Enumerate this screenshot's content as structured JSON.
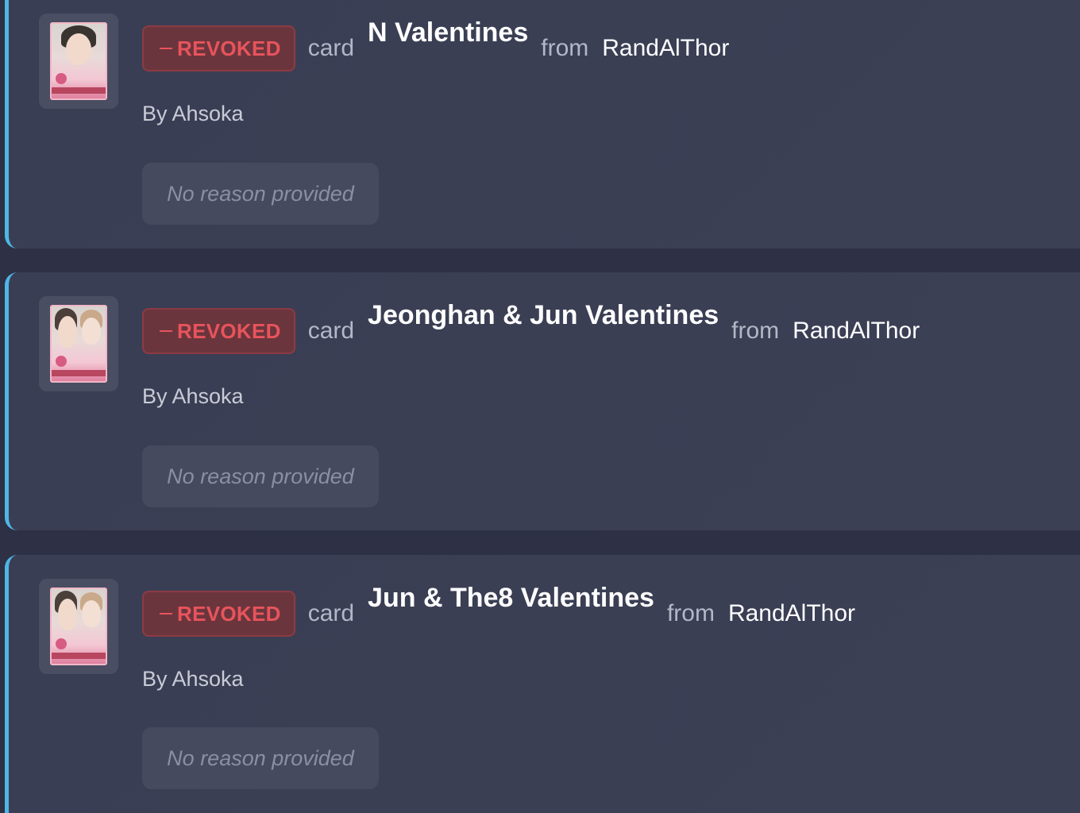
{
  "colors": {
    "accent_border": "#4fb6e8",
    "revoked_text": "#e8545c",
    "revoked_bg": "#6b353d",
    "card_bg": "#3a3e54",
    "page_bg": "#2e3145"
  },
  "entries": [
    {
      "status": "REVOKED",
      "type_word": "card",
      "card_name": "N Valentines",
      "from_word": "from",
      "recipient": "RandAlThor",
      "byline": "By Ahsoka",
      "reason": "No reason provided",
      "thumb_icon": "photocard-thumbnail"
    },
    {
      "status": "REVOKED",
      "type_word": "card",
      "card_name": "Jeonghan & Jun Valentines",
      "from_word": "from",
      "recipient": "RandAlThor",
      "byline": "By Ahsoka",
      "reason": "No reason provided",
      "thumb_icon": "photocard-thumbnail"
    },
    {
      "status": "REVOKED",
      "type_word": "card",
      "card_name": "Jun & The8 Valentines",
      "from_word": "from",
      "recipient": "RandAlThor",
      "byline": "By Ahsoka",
      "reason": "No reason provided",
      "thumb_icon": "photocard-thumbnail"
    }
  ]
}
